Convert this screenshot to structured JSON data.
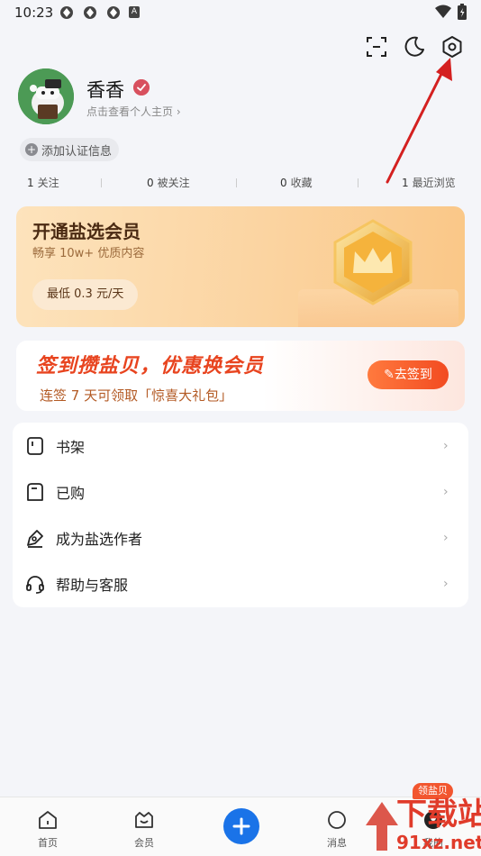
{
  "status_bar": {
    "time": "10:23",
    "sys_icon_letter": "A"
  },
  "profile": {
    "username": "香香",
    "profile_link": "点击查看个人主页 ›",
    "add_cert": "添加认证信息"
  },
  "stats": [
    {
      "num": "1",
      "label": "关注"
    },
    {
      "num": "0",
      "label": "被关注"
    },
    {
      "num": "0",
      "label": "收藏"
    },
    {
      "num": "1",
      "label": "最近浏览"
    }
  ],
  "vip": {
    "title": "开通盐选会员",
    "subtitle": "畅享 10w+ 优质内容",
    "price_button": "最低 0.3 元/天"
  },
  "sign_in": {
    "title": "签到攒盐贝，优惠换会员",
    "subtitle": "连签 7 天可领取「惊喜大礼包」",
    "button": "去签到"
  },
  "menu": [
    {
      "label": "书架",
      "icon": "bookshelf-icon"
    },
    {
      "label": "已购",
      "icon": "purchased-icon"
    },
    {
      "label": "成为盐选作者",
      "icon": "pen-icon"
    },
    {
      "label": "帮助与客服",
      "icon": "headset-icon"
    }
  ],
  "bottom_nav": [
    {
      "label": "首页",
      "icon": "home-icon"
    },
    {
      "label": "会员",
      "icon": "vip-icon"
    },
    {
      "label": "消息",
      "icon": "message-icon"
    },
    {
      "label": "我的",
      "icon": "profile-icon"
    }
  ],
  "badge": "领盐贝",
  "watermark": {
    "line1": "下载站",
    "line2": "91xz.net"
  },
  "colors": {
    "accent_blue": "#1a73e8",
    "sign_orange": "#f24b21",
    "vip_brown": "#4a2a12",
    "annotation_red": "#d42020"
  }
}
